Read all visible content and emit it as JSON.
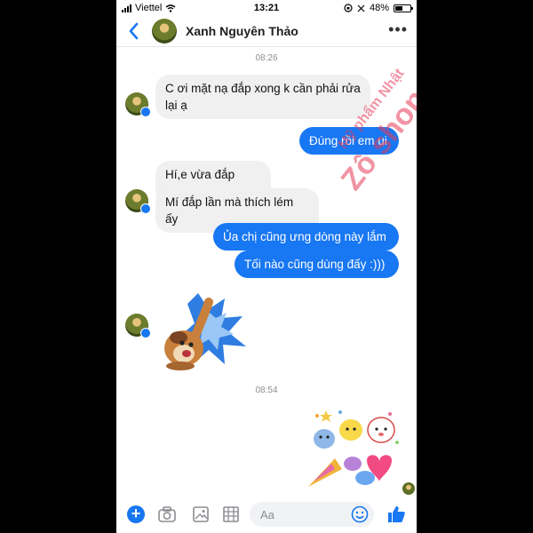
{
  "status_bar": {
    "carrier": "Viettel",
    "time": "13:21",
    "battery": "48%",
    "battery_level": 0.48
  },
  "header": {
    "contact_name": "Xanh Nguyên Thảo"
  },
  "messages": [
    {
      "time": "08:26"
    },
    {
      "text1": "C ơi mặt nạ đắp xong k cần phải rửa",
      "text2": "lại ạ"
    },
    {
      "text": "Đúng rồi em ui"
    },
    {
      "text": "Hí,e vừa đắp xong"
    },
    {
      "text": "Mí đắp lần mà thích lém ấy"
    },
    {
      "text": "Ủa chị cũng ưng dòng này lắm"
    },
    {
      "text": "Tối nào cũng dùng đấy :)))"
    },
    {
      "time": "08:54"
    }
  ],
  "watermark": {
    "line1": "Mỹ phẩm Nhật",
    "line2": "Zô shop"
  },
  "composer": {
    "placeholder": "Aa"
  },
  "colors": {
    "accent": "#1877f2",
    "incoming_bubble": "#f0f0f0"
  }
}
